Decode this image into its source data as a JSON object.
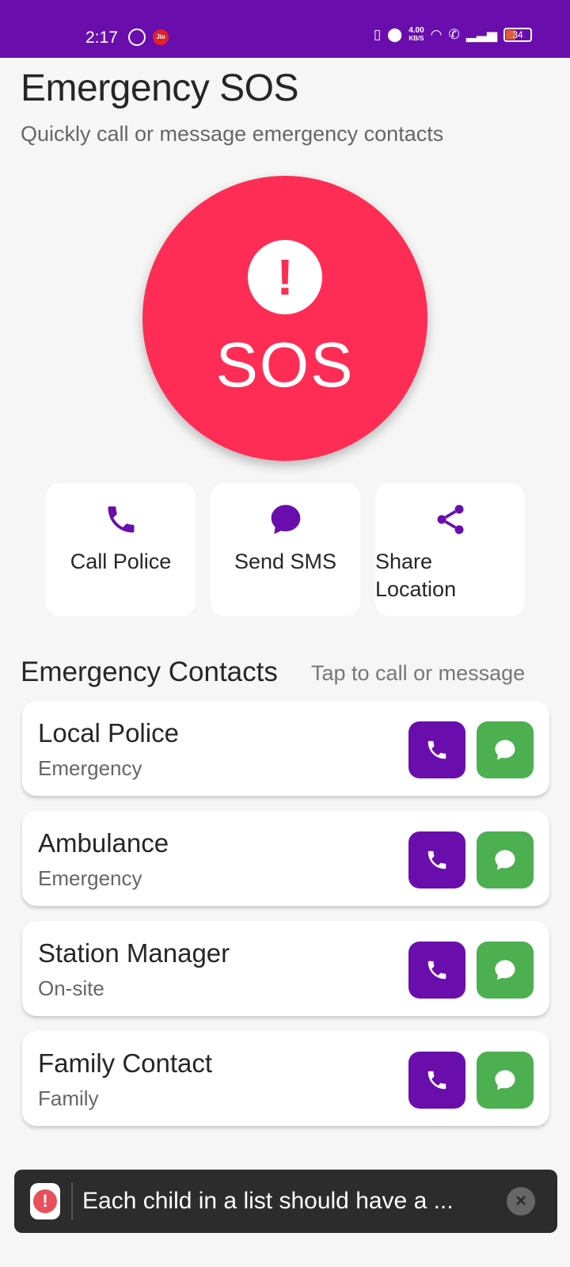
{
  "status_bar": {
    "time": "2:17",
    "carrier_badge": "Jio",
    "net_speed_value": "4.00",
    "net_speed_unit": "KB/S",
    "battery": "34",
    "color": "#6a0dad"
  },
  "header": {
    "title": "Emergency SOS",
    "subtitle": "Quickly call or message emergency contacts"
  },
  "sos": {
    "icon": "exclamation-icon",
    "label": "SOS",
    "color": "#ff2d55"
  },
  "actions": [
    {
      "label": "Call Police",
      "icon": "phone-icon"
    },
    {
      "label": "Send SMS",
      "icon": "chat-bubble-icon"
    },
    {
      "label": "Share Location",
      "icon": "share-icon"
    }
  ],
  "contacts_section": {
    "title": "Emergency Contacts",
    "hint": "Tap to call or message"
  },
  "contacts": [
    {
      "name": "Local Police",
      "type": "Emergency"
    },
    {
      "name": "Ambulance",
      "type": "Emergency"
    },
    {
      "name": "Station Manager",
      "type": "On-site"
    },
    {
      "name": "Family Contact",
      "type": "Family"
    }
  ],
  "toast": {
    "text": "Each child in a list should have a ...",
    "icon": "error-icon"
  },
  "colors": {
    "accent": "#6a0dad",
    "sos": "#ff2d55",
    "message": "#4caf50"
  }
}
